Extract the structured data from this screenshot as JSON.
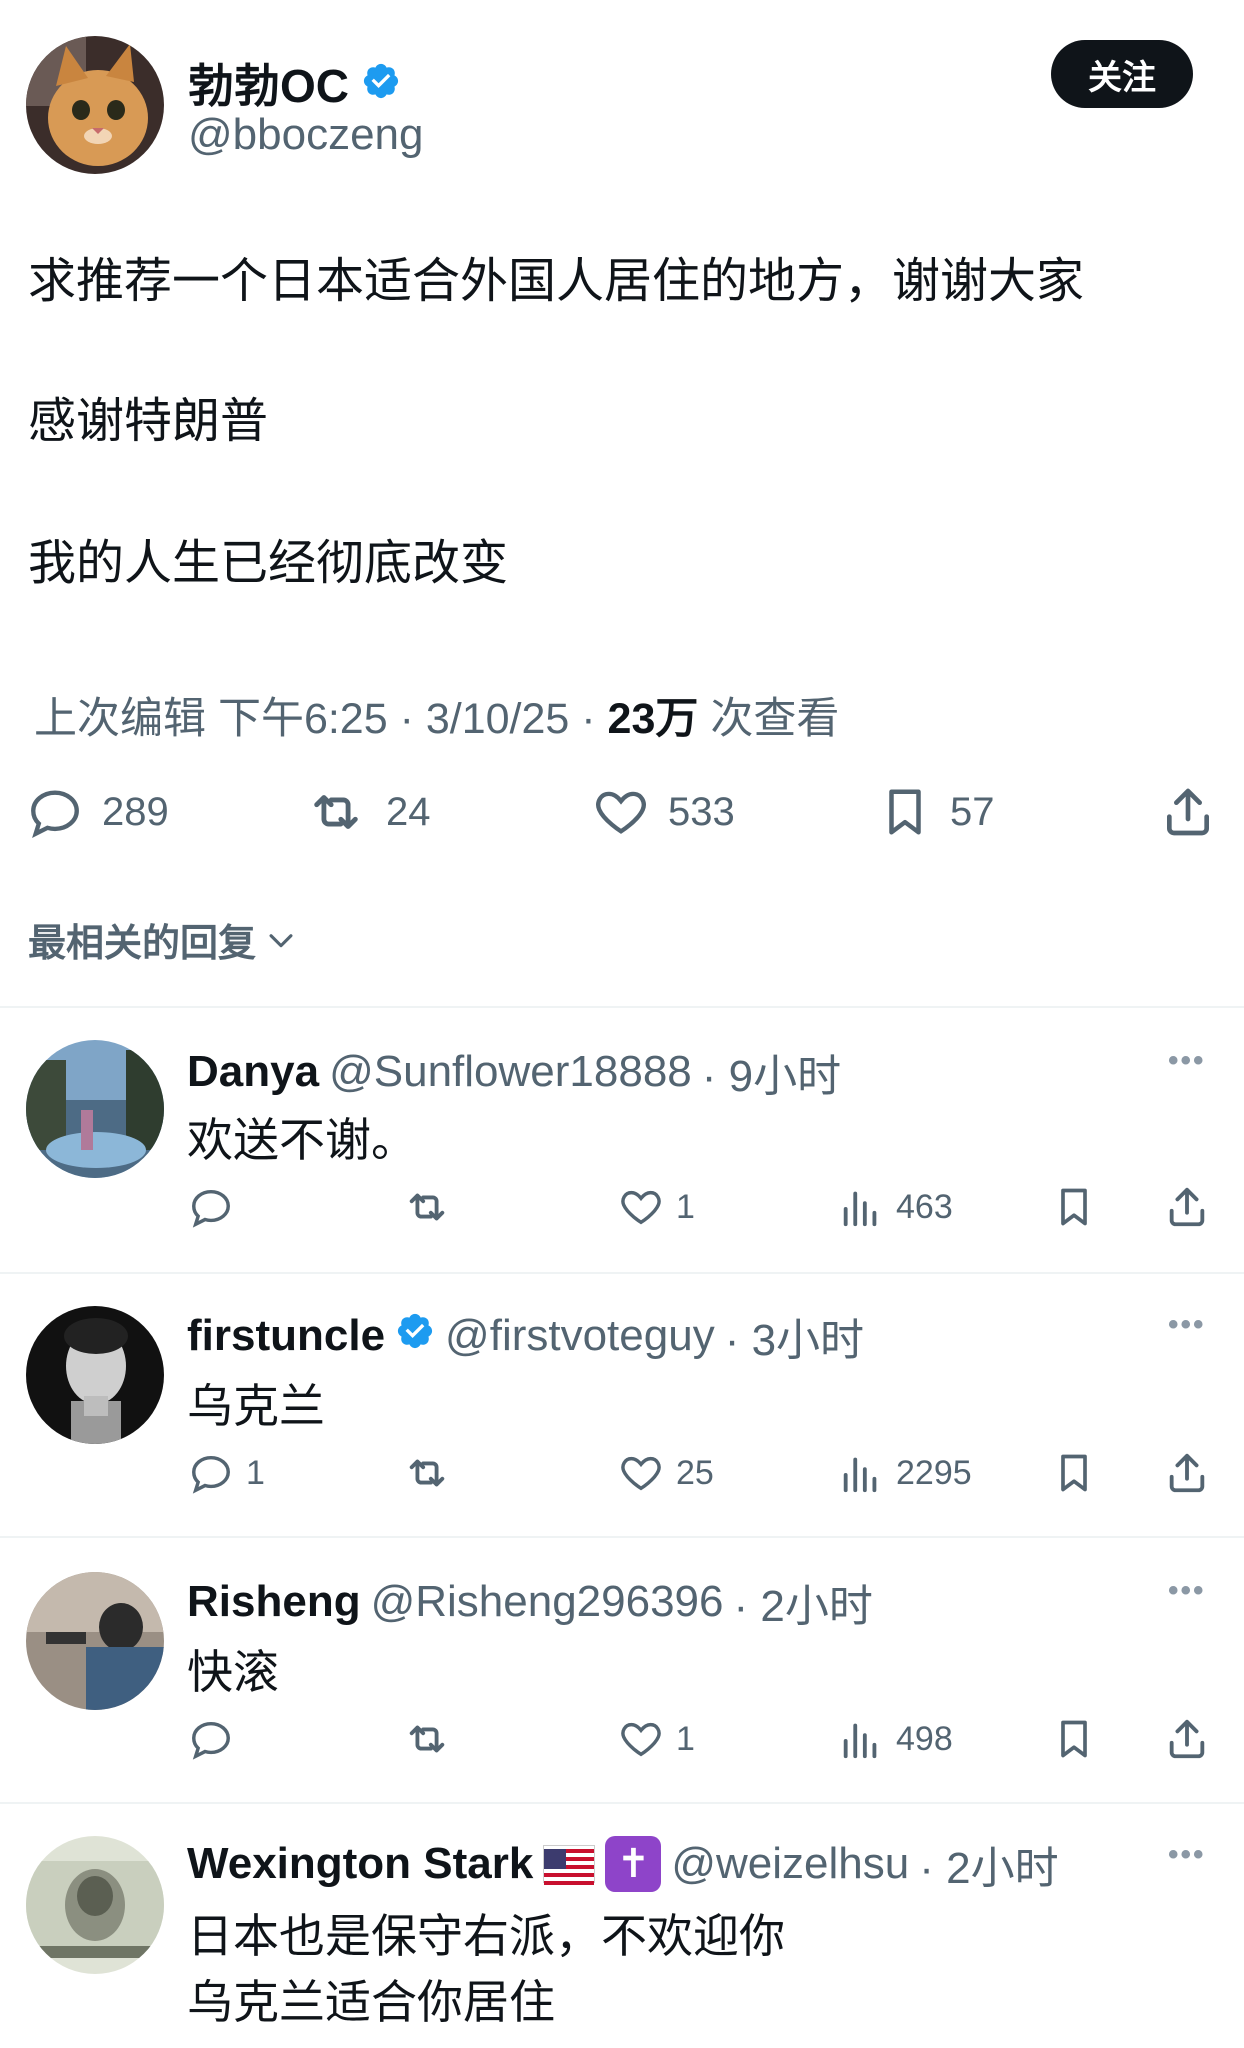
{
  "author": {
    "name": "勃勃OC",
    "handle": "@bboczeng",
    "follow_label": "关注"
  },
  "tweet": {
    "lines": [
      "求推荐一个日本适合外国人居住的地方，谢谢大家",
      "感谢特朗普",
      "我的人生已经彻底改变"
    ],
    "meta_prefix": "上次编辑 下午6:25 · 3/10/25 ·",
    "views_count": "23万",
    "views_label": "次查看"
  },
  "stats": {
    "replies": "289",
    "retweets": "24",
    "likes": "533",
    "bookmarks": "57"
  },
  "sort_label": "最相关的回复",
  "replies": [
    {
      "name": "Danya",
      "handle": "@Sunflower18888",
      "time": "· 9小时",
      "text": "欢送不谢。",
      "replies": "",
      "likes": "1",
      "views": "463",
      "verified": false
    },
    {
      "name": "firstuncle",
      "handle": "@firstvoteguy",
      "time": "· 3小时",
      "text": "乌克兰",
      "replies": "1",
      "likes": "25",
      "views": "2295",
      "verified": true
    },
    {
      "name": "Risheng",
      "handle": "@Risheng296396",
      "time": "· 2小时",
      "text": "快滚",
      "replies": "",
      "likes": "1",
      "views": "498",
      "verified": false
    },
    {
      "name": "Wexington Stark",
      "handle": "@weizelhsu",
      "time": "· 2小时",
      "text_lines": [
        "日本也是保守右派，不欢迎你",
        "乌克兰适合你居住"
      ],
      "emoji_cross": "✝"
    }
  ],
  "colors": {
    "text": "#0f1419",
    "muted": "#536471",
    "verified": "#1d9bf0",
    "divider": "#eff3f4"
  }
}
